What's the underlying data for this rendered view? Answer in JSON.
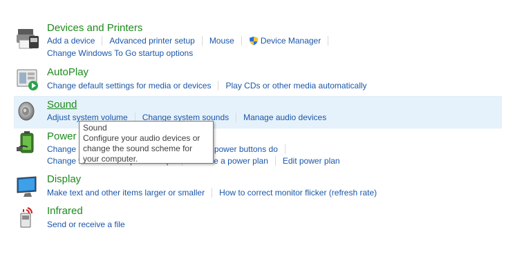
{
  "categories": [
    {
      "id": "devices",
      "title": "Devices and Printers",
      "icon": "printer-device-icon",
      "links_row1": [
        "Add a device",
        "Advanced printer setup",
        "Mouse",
        "Device Manager"
      ],
      "links_row2": [
        "Change Windows To Go startup options"
      ]
    },
    {
      "id": "autoplay",
      "title": "AutoPlay",
      "icon": "autoplay-icon",
      "links_row1": [
        "Change default settings for media or devices",
        "Play CDs or other media automatically"
      ]
    },
    {
      "id": "sound",
      "title": "Sound",
      "icon": "speaker-icon",
      "links_row1": [
        "Adjust system volume",
        "Change system sounds",
        "Manage audio devices"
      ]
    },
    {
      "id": "power",
      "title": "Power Options",
      "icon": "battery-plug-icon",
      "links_row1": [
        "Change battery settings",
        "Change what the power buttons do"
      ],
      "links_row2": [
        "Change when the computer sleeps",
        "Choose a power plan",
        "Edit power plan"
      ]
    },
    {
      "id": "display",
      "title": "Display",
      "icon": "monitor-icon",
      "links_row1": [
        "Make text and other items larger or smaller",
        "How to correct monitor flicker (refresh rate)"
      ]
    },
    {
      "id": "infrared",
      "title": "Infrared",
      "icon": "infrared-icon",
      "links_row1": [
        "Send or receive a file"
      ]
    }
  ],
  "tooltip": {
    "title": "Sound",
    "body": "Configure your audio devices or change the sound scheme for your computer."
  },
  "colors": {
    "category_title": "#1e8a1e",
    "link": "#1a56a8",
    "hover_highlight": "#e6f2fb"
  }
}
